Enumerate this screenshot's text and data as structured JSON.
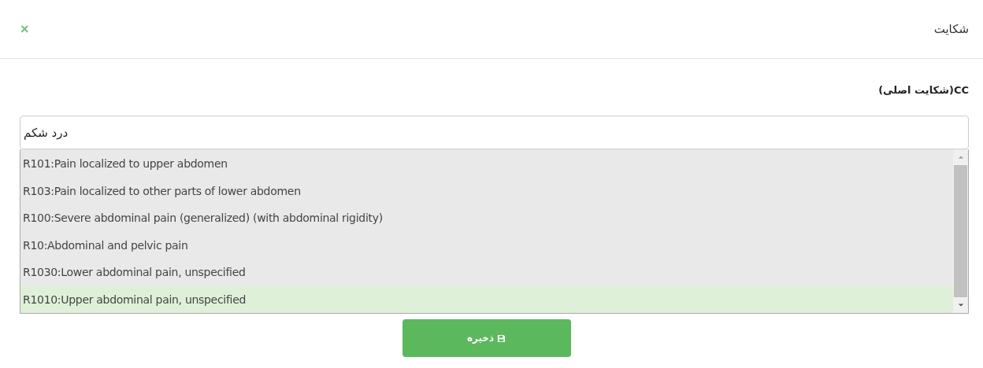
{
  "dialog": {
    "title": "شکایت",
    "close": "×"
  },
  "field": {
    "label": "CC(شکایت اصلی)",
    "value": "درد شکم"
  },
  "suggestions": [
    {
      "text": "R101:Pain localized to upper abdomen",
      "selected": false
    },
    {
      "text": "R103:Pain localized to other parts of lower abdomen",
      "selected": false
    },
    {
      "text": "R100:Severe abdominal pain (generalized) (with abdominal rigidity)",
      "selected": false
    },
    {
      "text": "R10:Abdominal and pelvic pain",
      "selected": false
    },
    {
      "text": "R1030:Lower abdominal pain, unspecified",
      "selected": false
    },
    {
      "text": "R1010:Upper abdominal pain, unspecified",
      "selected": true
    }
  ],
  "save_button": {
    "label": "ذخیره"
  }
}
